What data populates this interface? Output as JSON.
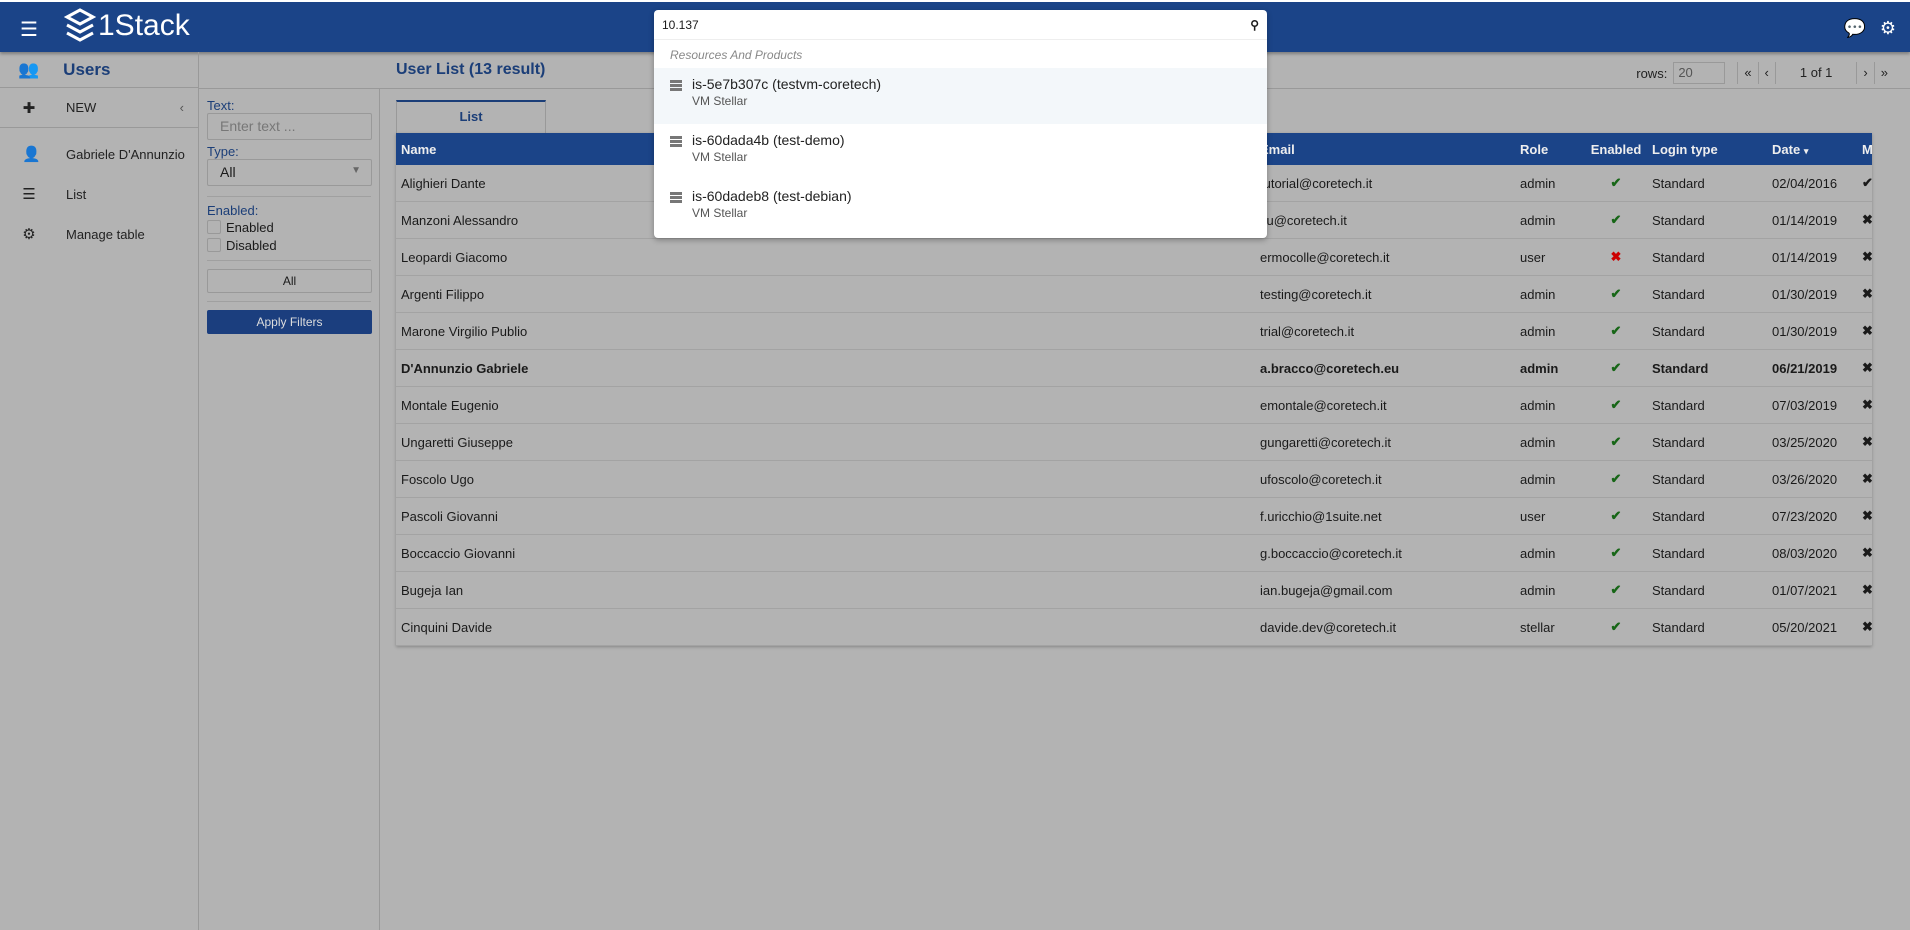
{
  "header": {
    "logo": "1Stack",
    "icons": [
      "menu-icon",
      "chat-icon",
      "gear-icon"
    ]
  },
  "sidebar": {
    "title": "Users",
    "items": [
      {
        "label": "NEW",
        "icon": "plus-icon"
      },
      {
        "label": "Gabriele D'Annunzio",
        "icon": "user-icon"
      },
      {
        "label": "List",
        "icon": "list-icon"
      },
      {
        "label": "Manage table",
        "icon": "gears-icon"
      }
    ]
  },
  "filters": {
    "text_label": "Text:",
    "text_placeholder": "Enter text ...",
    "type_label": "Type:",
    "type_value": "All",
    "enabled_label": "Enabled:",
    "enabled_opt": "Enabled",
    "disabled_opt": "Disabled",
    "all_button": "All",
    "apply_button": "Apply Filters"
  },
  "main": {
    "title": "User List (13 result)",
    "rows_label": "rows:",
    "rows_value": "20",
    "page": "1 of 1",
    "tab": "List"
  },
  "table": {
    "columns": [
      "Name",
      "Email",
      "Role",
      "Enabled",
      "Login type",
      "Date",
      "Main"
    ],
    "sort_indicator": "▾",
    "rows": [
      {
        "name": "Alighieri Dante",
        "email": "tutorial@coretech.it",
        "role": "admin",
        "enabled": true,
        "login": "Standard",
        "date": "02/04/2016",
        "main": true
      },
      {
        "name": "Manzoni Alessandro",
        "email": "ifu@coretech.it",
        "role": "admin",
        "enabled": true,
        "login": "Standard",
        "date": "01/14/2019",
        "main": false
      },
      {
        "name": "Leopardi Giacomo",
        "email": "ermocolle@coretech.it",
        "role": "user",
        "enabled": false,
        "login": "Standard",
        "date": "01/14/2019",
        "main": false
      },
      {
        "name": "Argenti Filippo",
        "email": "testing@coretech.it",
        "role": "admin",
        "enabled": true,
        "login": "Standard",
        "date": "01/30/2019",
        "main": false
      },
      {
        "name": "Marone Virgilio Publio",
        "email": "trial@coretech.it",
        "role": "admin",
        "enabled": true,
        "login": "Standard",
        "date": "01/30/2019",
        "main": false
      },
      {
        "name": "D'Annunzio Gabriele",
        "email": "a.bracco@coretech.eu",
        "role": "admin",
        "enabled": true,
        "login": "Standard",
        "date": "06/21/2019",
        "main": false,
        "bold": true
      },
      {
        "name": "Montale Eugenio",
        "email": "emontale@coretech.it",
        "role": "admin",
        "enabled": true,
        "login": "Standard",
        "date": "07/03/2019",
        "main": false
      },
      {
        "name": "Ungaretti Giuseppe",
        "email": "gungaretti@coretech.it",
        "role": "admin",
        "enabled": true,
        "login": "Standard",
        "date": "03/25/2020",
        "main": false
      },
      {
        "name": "Foscolo Ugo",
        "email": "ufoscolo@coretech.it",
        "role": "admin",
        "enabled": true,
        "login": "Standard",
        "date": "03/26/2020",
        "main": false
      },
      {
        "name": "Pascoli Giovanni",
        "email": "f.uricchio@1suite.net",
        "role": "user",
        "enabled": true,
        "login": "Standard",
        "date": "07/23/2020",
        "main": false
      },
      {
        "name": "Boccaccio Giovanni",
        "email": "g.boccaccio@coretech.it",
        "role": "admin",
        "enabled": true,
        "login": "Standard",
        "date": "08/03/2020",
        "main": false
      },
      {
        "name": "Bugeja Ian",
        "email": "ian.bugeja@gmail.com",
        "role": "admin",
        "enabled": true,
        "login": "Standard",
        "date": "01/07/2021",
        "main": false
      },
      {
        "name": "Cinquini Davide",
        "email": "davide.dev@coretech.it",
        "role": "stellar",
        "enabled": true,
        "login": "Standard",
        "date": "05/20/2021",
        "main": false
      }
    ]
  },
  "search": {
    "value": "10.137",
    "group": "Resources And Products",
    "results": [
      {
        "title": "is-5e7b307c (testvm-coretech)",
        "sub": "VM Stellar"
      },
      {
        "title": "is-60dada4b (test-demo)",
        "sub": "VM Stellar"
      },
      {
        "title": "is-60dadeb8 (test-debian)",
        "sub": "VM Stellar"
      }
    ]
  },
  "colors": {
    "brand": "#1b4488",
    "enabled_ok": "#176617",
    "enabled_no": "#cc0000",
    "backdrop": "#b3b3b3"
  }
}
